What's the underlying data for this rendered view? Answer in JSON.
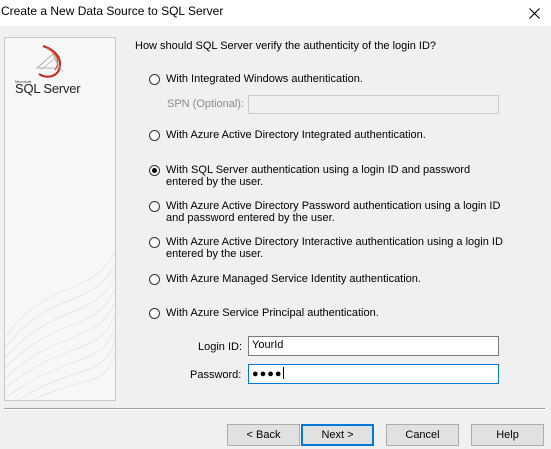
{
  "window": {
    "title": "Create a New Data Source to SQL Server"
  },
  "sidebar": {
    "logo_small": "Microsoft",
    "logo_word": "SQL Server"
  },
  "main": {
    "question": "How should SQL Server verify the authenticity of the login ID?",
    "auth_options": [
      {
        "label": "With Integrated Windows authentication.",
        "checked": false
      },
      {
        "label": "With Azure Active Directory Integrated authentication.",
        "checked": false
      },
      {
        "label": "With SQL Server authentication using a login ID and password entered by the user.",
        "checked": true
      },
      {
        "label": "With Azure Active Directory Password authentication using a login ID and password entered by the user.",
        "checked": false
      },
      {
        "label": "With Azure Active Directory Interactive authentication using a login ID entered by the user.",
        "checked": false
      },
      {
        "label": "With Azure Managed Service Identity authentication.",
        "checked": false
      },
      {
        "label": "With Azure Service Principal authentication.",
        "checked": false
      }
    ],
    "spn": {
      "label": "SPN (Optional):",
      "value": "",
      "disabled": true
    },
    "login_id": {
      "label": "Login ID:",
      "value": "YourId"
    },
    "password": {
      "label": "Password:",
      "masked_value": "●●●●"
    }
  },
  "buttons": {
    "back": "< Back",
    "next": "Next >",
    "cancel": "Cancel",
    "help": "Help"
  },
  "colors": {
    "focus_accent": "#0078d7",
    "dialog_bg": "#f0f0f0"
  },
  "icons": [
    "close-icon",
    "sql-server-logo-icon"
  ]
}
